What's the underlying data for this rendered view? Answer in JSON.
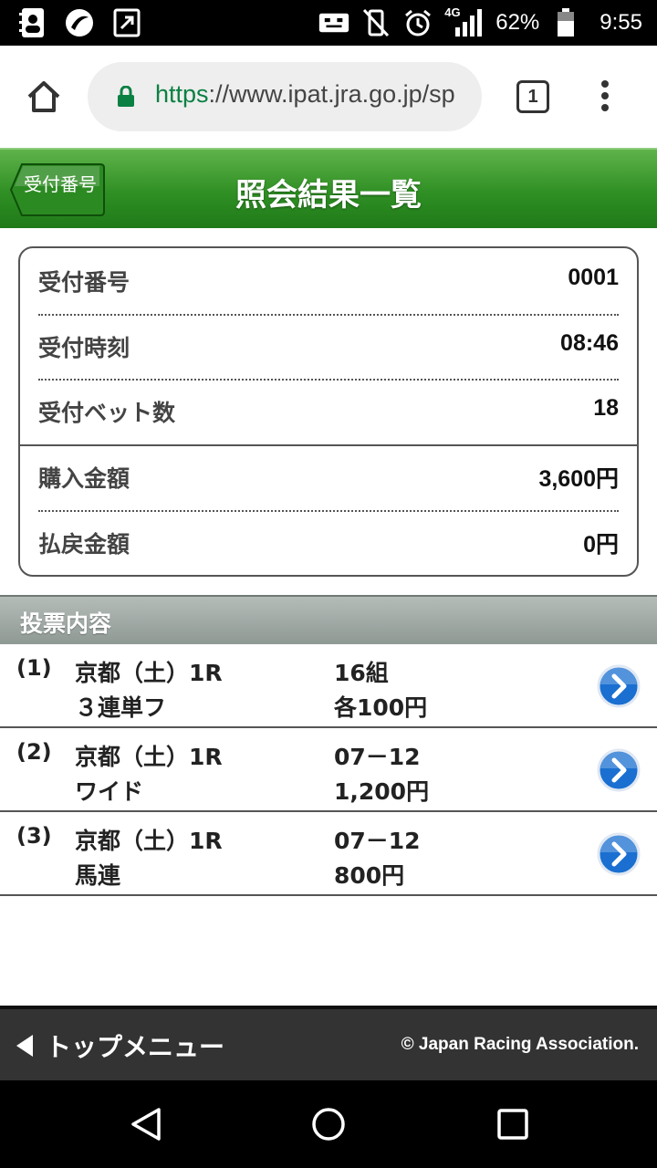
{
  "status_bar": {
    "battery": "62%",
    "network": "4G",
    "time": "9:55"
  },
  "browser": {
    "url_scheme": "https",
    "url_rest": "://www.ipat.jra.go.jp/sp",
    "tab_count": "1"
  },
  "header": {
    "back_label": "受付番号",
    "title": "照会結果一覧"
  },
  "summary": {
    "rows": [
      {
        "label": "受付番号",
        "value": "0001"
      },
      {
        "label": "受付時刻",
        "value": "08:46"
      },
      {
        "label": "受付ベット数",
        "value": "18"
      },
      {
        "label": "購入金額",
        "value": "3,600円"
      },
      {
        "label": "払戻金額",
        "value": "0円"
      }
    ]
  },
  "bets_section": {
    "title": "投票内容",
    "items": [
      {
        "index": "(1)",
        "venue": "京都（土）1R",
        "type": "３連単フ",
        "combo": "16組",
        "amount": "各100円"
      },
      {
        "index": "(2)",
        "venue": "京都（土）1R",
        "type": "ワイド",
        "combo": "07－12",
        "amount": "1,200円"
      },
      {
        "index": "(3)",
        "venue": "京都（土）1R",
        "type": "馬連",
        "combo": "07－12",
        "amount": "800円"
      }
    ]
  },
  "footer": {
    "top_menu": "トップメニュー",
    "copyright": "© Japan Racing Association."
  },
  "colors": {
    "header_green": "#2f8f24",
    "link_blue": "#1a6fd1"
  }
}
